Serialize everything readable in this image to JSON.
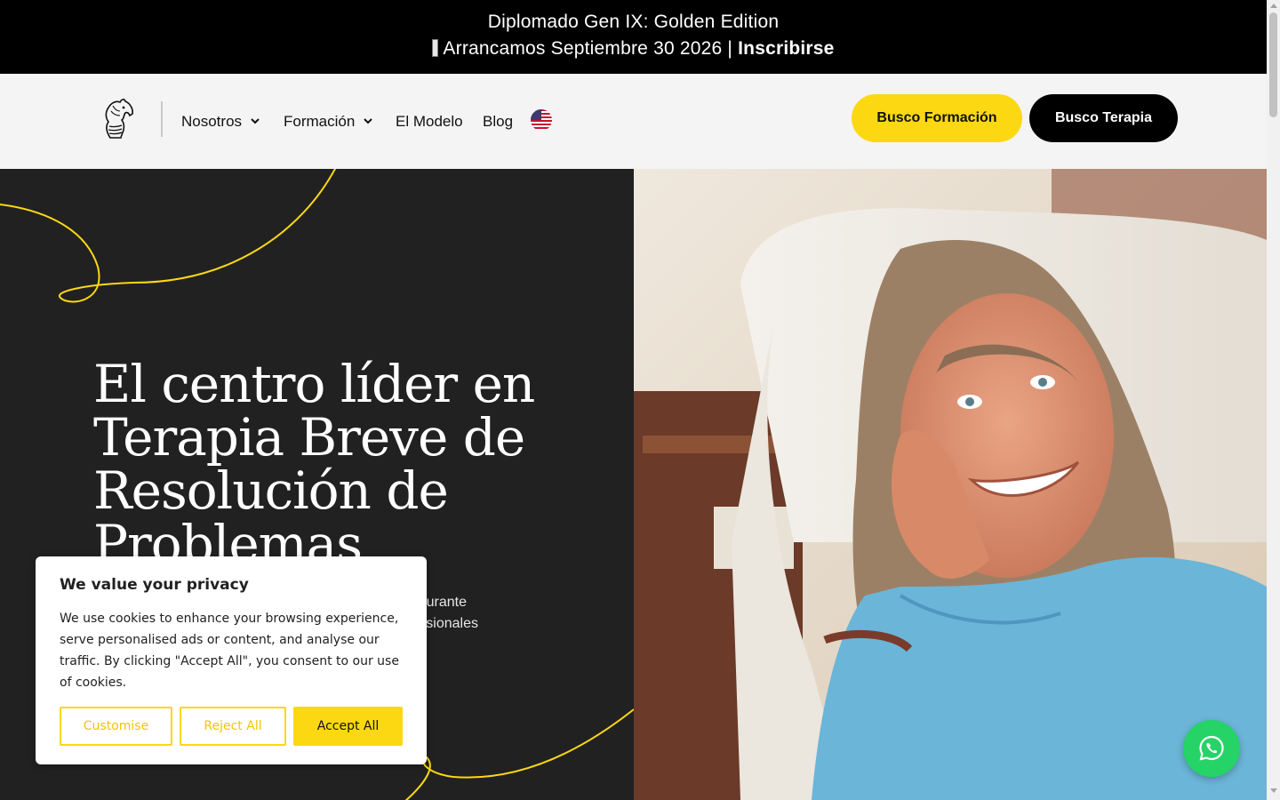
{
  "announcement": {
    "line1": "Diplomado Gen IX: Golden Edition",
    "line2": "Arrancamos Septiembre 30 2026 |",
    "cta": "Inscribirse",
    "icon": "calendar-icon"
  },
  "header": {
    "logo": "horse-head-logo",
    "nav": [
      {
        "label": "Nosotros",
        "has_dropdown": true
      },
      {
        "label": "Formación",
        "has_dropdown": true
      },
      {
        "label": "El Modelo",
        "has_dropdown": false
      },
      {
        "label": "Blog",
        "has_dropdown": false
      }
    ],
    "language_icon": "us-flag-icon",
    "btn_formacion": "Busco Formación",
    "btn_terapia": "Busco Terapia"
  },
  "hero": {
    "headline": "El centro líder en Terapia Breve de Resolución de Problemas",
    "subtext_line1": "urante",
    "subtext_line2": "sionales"
  },
  "cookie": {
    "title": "We value your privacy",
    "body": "We use cookies to enhance your browsing experience, serve personalised ads or content, and analyse our traffic. By clicking \"Accept All\", you consent to our use of cookies.",
    "customise": "Customise",
    "reject": "Reject All",
    "accept": "Accept All"
  },
  "whatsapp": {
    "icon": "whatsapp-icon"
  },
  "colors": {
    "accent": "#fcd812",
    "dark": "#212121",
    "black": "#000000",
    "whatsapp": "#25d366"
  }
}
